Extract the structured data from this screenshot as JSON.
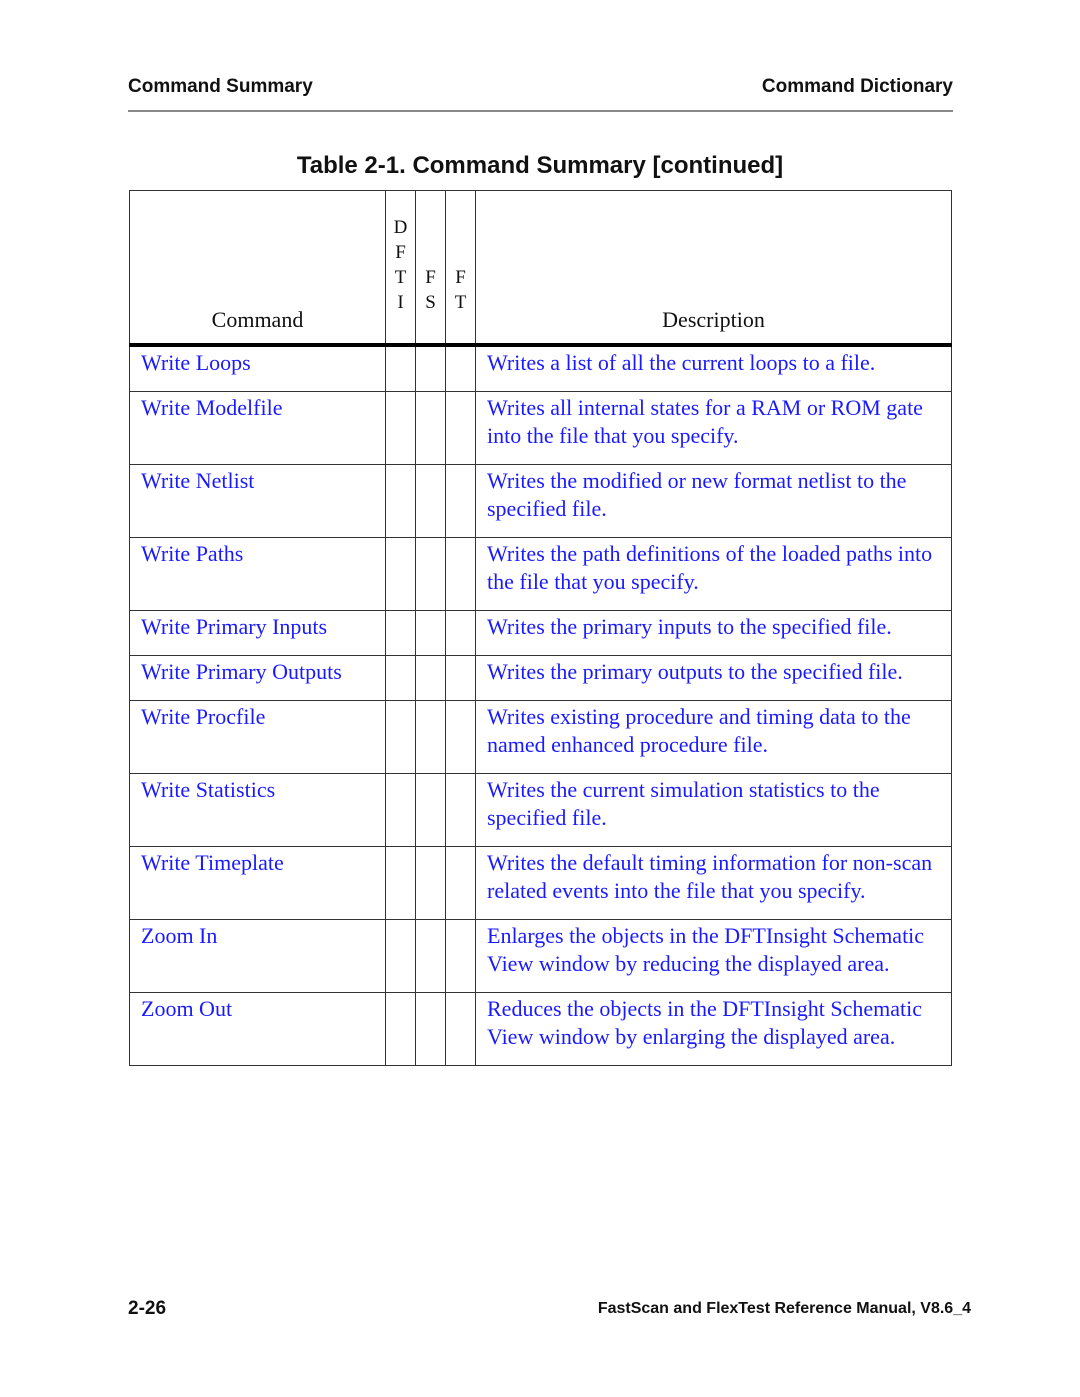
{
  "running_header": {
    "left": "Command Summary",
    "right": "Command Dictionary"
  },
  "table_title": "Table 2-1. Command Summary [continued]",
  "table": {
    "headers": {
      "command": "Command",
      "flags": [
        {
          "letters": [
            "D",
            "F",
            "T",
            "I"
          ]
        },
        {
          "letters": [
            "F",
            "S"
          ]
        },
        {
          "letters": [
            "F",
            "T"
          ]
        }
      ],
      "description": "Description"
    },
    "rows": [
      {
        "command": "Write Loops",
        "dfti": "",
        "fs": "",
        "ft": "",
        "description": "Writes a list of all the current loops to a file."
      },
      {
        "command": "Write Modelfile",
        "dfti": "",
        "fs": "",
        "ft": "",
        "description": "Writes all internal states for a RAM or ROM gate into the file that you specify."
      },
      {
        "command": "Write Netlist",
        "dfti": "",
        "fs": "",
        "ft": "",
        "description": "Writes the modified or new format netlist to the specified file."
      },
      {
        "command": "Write Paths",
        "dfti": "",
        "fs": "",
        "ft": "",
        "description": "Writes the path definitions of the loaded paths into the file that you specify."
      },
      {
        "command": "Write Primary Inputs",
        "dfti": "",
        "fs": "",
        "ft": "",
        "description": "Writes the primary inputs to the specified file."
      },
      {
        "command": "Write Primary Outputs",
        "dfti": "",
        "fs": "",
        "ft": "",
        "description": "Writes the primary outputs to the specified file."
      },
      {
        "command": "Write Procfile",
        "dfti": "",
        "fs": "",
        "ft": "",
        "description": "Writes existing procedure and timing data to the named enhanced procedure file."
      },
      {
        "command": "Write Statistics",
        "dfti": "",
        "fs": "",
        "ft": "",
        "description": "Writes the current simulation statistics to the specified file."
      },
      {
        "command": "Write Timeplate",
        "dfti": "",
        "fs": "",
        "ft": "",
        "description": "Writes the default timing information for non-scan related events into the file that you specify."
      },
      {
        "command": "Zoom In",
        "dfti": "",
        "fs": "",
        "ft": "",
        "description": "Enlarges the objects in the DFTInsight Schematic View window by reducing the displayed area."
      },
      {
        "command": "Zoom Out",
        "dfti": "",
        "fs": "",
        "ft": "",
        "description": "Reduces the objects in the DFTInsight Schematic View window by enlarging the displayed area."
      }
    ]
  },
  "footer": {
    "page_number": "2-26",
    "manual_title": "FastScan and FlexTest Reference Manual, V8.6_4"
  },
  "colors": {
    "link": "#1a1aff",
    "text": "#111111",
    "rule": "#8a8a8a"
  }
}
